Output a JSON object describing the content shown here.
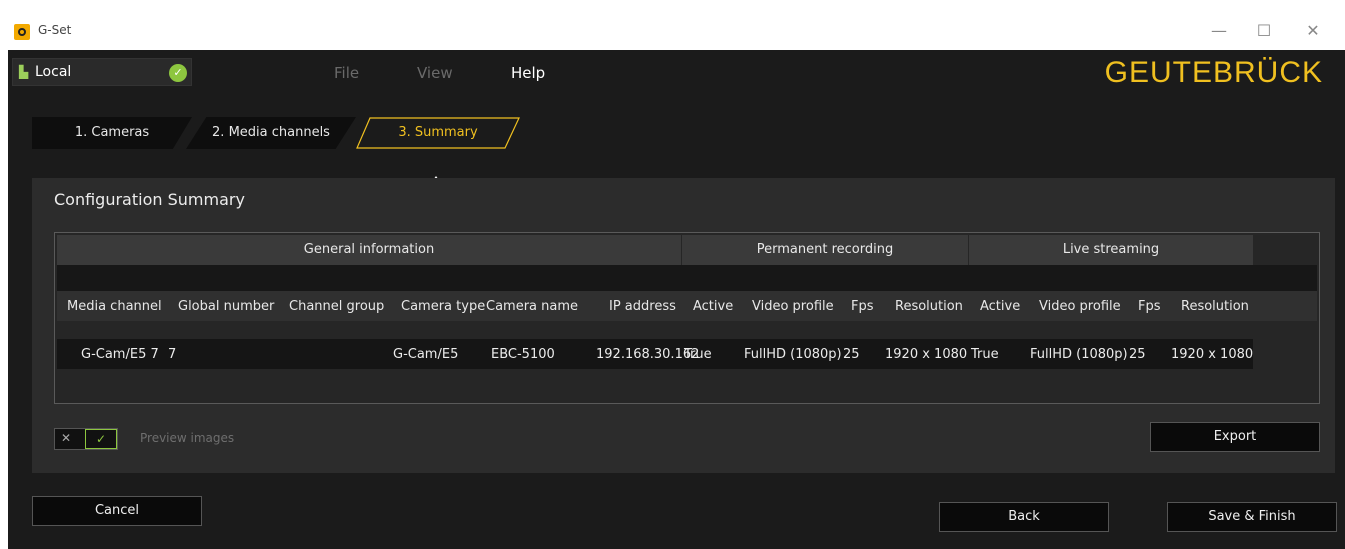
{
  "window": {
    "title": "G-Set",
    "controls": {
      "minimize": "—",
      "maximize": "☐",
      "close": "✕"
    }
  },
  "connection": {
    "label": "Local",
    "status": "connected"
  },
  "menu": {
    "file": "File",
    "view": "View",
    "help": "Help"
  },
  "brand": "GEUTEBRÜCK",
  "tabs": [
    {
      "label": "1. Cameras"
    },
    {
      "label": "2. Media channels"
    },
    {
      "label": "3. Summary",
      "active": true
    }
  ],
  "summary": {
    "title": "Configuration Summary",
    "groups": {
      "general": "General information",
      "permanent": "Permanent recording",
      "live": "Live streaming"
    },
    "columns": [
      "Media channel",
      "Global number",
      "Channel group",
      "Camera type",
      "Camera name",
      "IP address",
      "Active",
      "Video profile",
      "Fps",
      "Resolution",
      "Active",
      "Video profile",
      "Fps",
      "Resolution"
    ],
    "rows": [
      [
        "G-Cam/E5 7",
        "7",
        "",
        "G-Cam/E5",
        "EBC-5100",
        "192.168.30.162",
        "True",
        "FullHD (1080p)",
        "25",
        "1920 x 1080",
        "True",
        "FullHD (1080p)",
        "25",
        "1920 x 1080"
      ]
    ]
  },
  "preview": {
    "label": "Preview images",
    "off_symbol": "✕",
    "on_symbol": "✓",
    "enabled": true
  },
  "buttons": {
    "export": "Export",
    "cancel": "Cancel",
    "back": "Back",
    "save_finish": "Save & Finish"
  },
  "colors": {
    "accent": "#f0c020",
    "ok": "#8dc63f",
    "background": "#1b1b1b",
    "panel": "#2c2c2c"
  }
}
